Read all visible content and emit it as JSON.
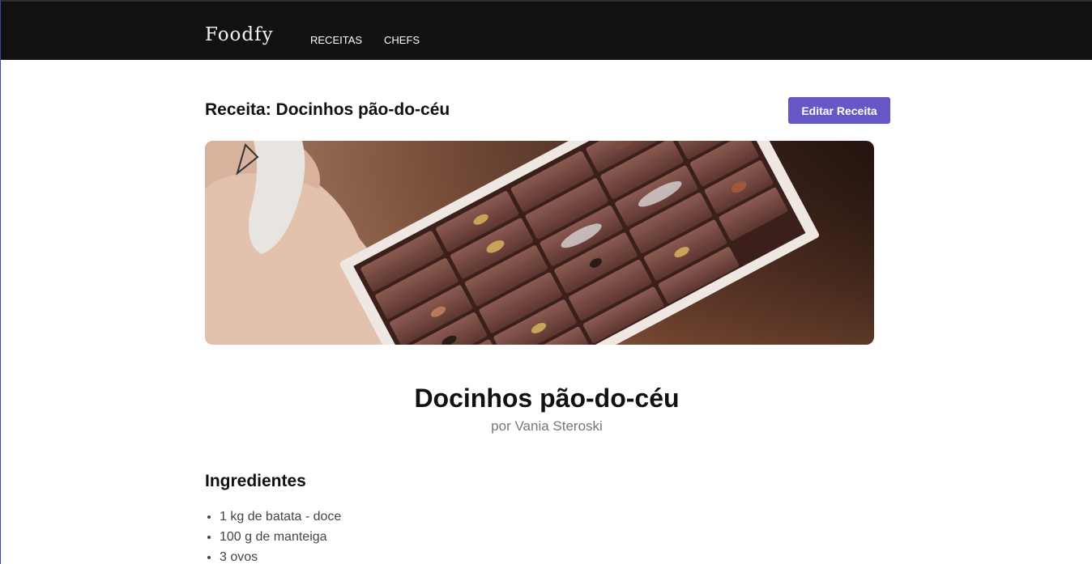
{
  "header": {
    "logo": "Foodfy",
    "nav": [
      {
        "label": "RECEITAS"
      },
      {
        "label": "CHEFS"
      }
    ]
  },
  "page": {
    "heading": "Receita: Docinhos pão-do-céu",
    "edit_button": "Editar Receita"
  },
  "recipe": {
    "image_alt": "chocolate box",
    "title": "Docinhos pão-do-céu",
    "author": "por Vania Steroski",
    "ingredients_title": "Ingredientes",
    "ingredients": [
      "1 kg de batata - doce",
      "100 g de manteiga",
      "3 ovos"
    ]
  },
  "colors": {
    "topbar": "#111111",
    "accent": "#6558c5",
    "muted_text": "#777777"
  }
}
